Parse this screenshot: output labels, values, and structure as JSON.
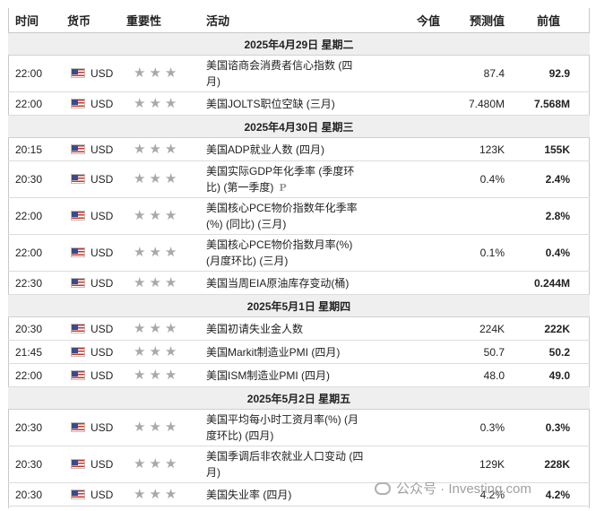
{
  "headers": {
    "time": "时间",
    "currency": "货币",
    "importance": "重要性",
    "event": "活动",
    "actual": "今值",
    "forecast": "预测值",
    "previous": "前值"
  },
  "days": [
    {
      "label": "2025年4月29日  星期二",
      "events": [
        {
          "time": "22:00",
          "currency": "USD",
          "line1": "美国谘商会消费者信心指数 (四",
          "line2": "月)",
          "forecast": "87.4",
          "previous": "92.9"
        },
        {
          "time": "22:00",
          "currency": "USD",
          "line1": "美国JOLTS职位空缺 (三月)",
          "line2": "",
          "forecast": "7.480M",
          "previous": "7.568M"
        }
      ]
    },
    {
      "label": "2025年4月30日  星期三",
      "events": [
        {
          "time": "20:15",
          "currency": "USD",
          "line1": "美国ADP就业人数 (四月)",
          "line2": "",
          "forecast": "123K",
          "previous": "155K"
        },
        {
          "time": "20:30",
          "currency": "USD",
          "line1": "美国实际GDP年化季率 (季度环",
          "line2": "比) (第一季度)",
          "preliminary": "P",
          "forecast": "0.4%",
          "previous": "2.4%"
        },
        {
          "time": "22:00",
          "currency": "USD",
          "line1": "美国核心PCE物价指数年化季率",
          "line2": "(%) (同比) (三月)",
          "forecast": "",
          "previous": "2.8%"
        },
        {
          "time": "22:00",
          "currency": "USD",
          "line1": "美国核心PCE物价指数月率(%)",
          "line2": "(月度环比) (三月)",
          "forecast": "0.1%",
          "previous": "0.4%"
        },
        {
          "time": "22:30",
          "currency": "USD",
          "line1": "美国当周EIA原油库存变动(桶)",
          "line2": "",
          "forecast": "",
          "previous": "0.244M"
        }
      ]
    },
    {
      "label": "2025年5月1日  星期四",
      "events": [
        {
          "time": "20:30",
          "currency": "USD",
          "line1": "美国初请失业金人数",
          "line2": "",
          "forecast": "224K",
          "previous": "222K"
        },
        {
          "time": "21:45",
          "currency": "USD",
          "line1": "美国Markit制造业PMI (四月)",
          "line2": "",
          "forecast": "50.7",
          "previous": "50.2"
        },
        {
          "time": "22:00",
          "currency": "USD",
          "line1": "美国ISM制造业PMI (四月)",
          "line2": "",
          "forecast": "48.0",
          "previous": "49.0"
        }
      ]
    },
    {
      "label": "2025年5月2日  星期五",
      "events": [
        {
          "time": "20:30",
          "currency": "USD",
          "line1": "美国平均每小时工资月率(%) (月",
          "line2": "度环比) (四月)",
          "forecast": "0.3%",
          "previous": "0.3%"
        },
        {
          "time": "20:30",
          "currency": "USD",
          "line1": "美国季调后非农就业人口变动 (四",
          "line2": "月)",
          "forecast": "129K",
          "previous": "228K"
        },
        {
          "time": "20:30",
          "currency": "USD",
          "line1": "美国失业率 (四月)",
          "line2": "",
          "forecast": "4.2%",
          "previous": "4.2%"
        }
      ]
    }
  ],
  "importance_stars": 3,
  "watermark": "公众号 · Investing.com"
}
